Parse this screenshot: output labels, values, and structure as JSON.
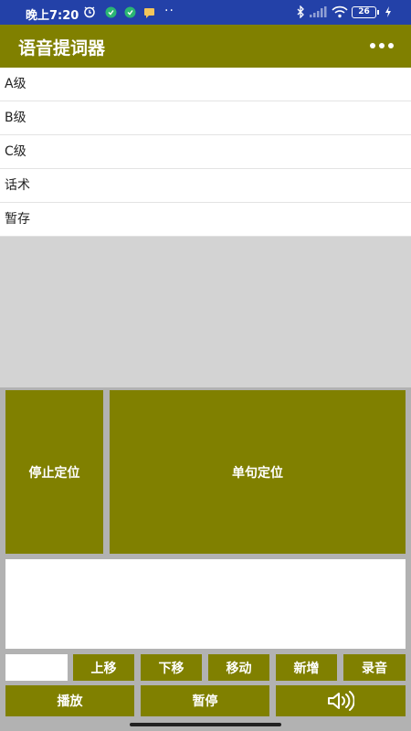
{
  "status_bar": {
    "time": "晚上7:20",
    "extra": "··",
    "battery": "26"
  },
  "app_bar": {
    "title": "语音提词器"
  },
  "list": {
    "items": [
      {
        "label": "A级"
      },
      {
        "label": "B级"
      },
      {
        "label": "C级"
      },
      {
        "label": "话术"
      },
      {
        "label": "暂存"
      }
    ]
  },
  "controls": {
    "stop_locate": "停止定位",
    "single_locate": "单句定位",
    "move_up": "上移",
    "move_down": "下移",
    "move": "移动",
    "add": "新增",
    "record": "录音",
    "play": "播放",
    "pause": "暂停"
  },
  "colors": {
    "status_bar": "#2341a8",
    "app_bar": "#808000",
    "button": "#808000",
    "panel": "#b2b2b2",
    "blank": "#d3d3d3"
  }
}
